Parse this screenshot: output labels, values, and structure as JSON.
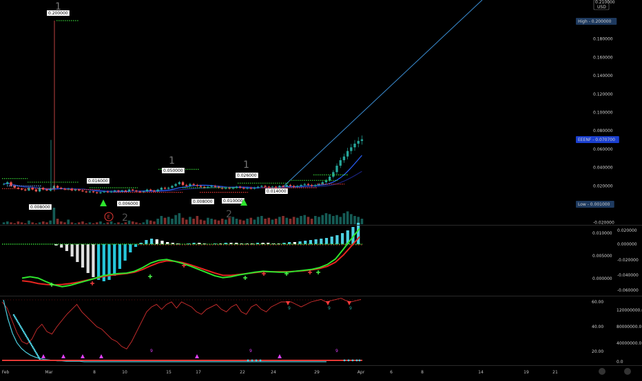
{
  "chart_data": [
    {
      "type": "candlestick",
      "panel": "price",
      "currency": "USD",
      "y_ticks": [
        "0.200000",
        "0.180000",
        "0.160000",
        "0.140000",
        "0.120000",
        "0.100000",
        "0.080000",
        "0.060000",
        "0.040000",
        "0.020000",
        "0.000000",
        "-0.020000"
      ],
      "ylim": [
        -0.02,
        0.22
      ],
      "x_ticks": [
        "Feb",
        "Mar",
        "8",
        "10",
        "15",
        "17",
        "22",
        "24",
        "29",
        "Apr",
        "6",
        "8",
        "14",
        "19",
        "21"
      ],
      "badges": {
        "high": "High - 0.200000",
        "last": "EEENF - 0.070700",
        "low": "Low - 0.001000",
        "currency": "USD",
        "top": "0.210000"
      },
      "series": [
        {
          "name": "close",
          "values": [
            0.022,
            0.024,
            0.02,
            0.018,
            0.017,
            0.016,
            0.015,
            0.018,
            0.016,
            0.014,
            0.018,
            0.016,
            0.015,
            0.017,
            0.02,
            0.018,
            0.017,
            0.016,
            0.017,
            0.015,
            0.016,
            0.015,
            0.014,
            0.013,
            0.014,
            0.013,
            0.012,
            0.013,
            0.014,
            0.013,
            0.014,
            0.015,
            0.014,
            0.015,
            0.014,
            0.016,
            0.015,
            0.014,
            0.013,
            0.014,
            0.016,
            0.015,
            0.014,
            0.016,
            0.018,
            0.017,
            0.018,
            0.02,
            0.022,
            0.024,
            0.021,
            0.02,
            0.022,
            0.021,
            0.02,
            0.019,
            0.018,
            0.019,
            0.02,
            0.019,
            0.018,
            0.017,
            0.018,
            0.017,
            0.018,
            0.019,
            0.018,
            0.017,
            0.018,
            0.017,
            0.018,
            0.019,
            0.02,
            0.019,
            0.018,
            0.019,
            0.018,
            0.02,
            0.019,
            0.021,
            0.02,
            0.019,
            0.02,
            0.021,
            0.022,
            0.021,
            0.02,
            0.021,
            0.022,
            0.024,
            0.026,
            0.03,
            0.035,
            0.042,
            0.048,
            0.052,
            0.058,
            0.062,
            0.066,
            0.069,
            0.0707
          ]
        },
        {
          "name": "volume",
          "values": [
            2,
            3,
            2,
            1,
            3,
            2,
            1,
            4,
            2,
            1,
            2,
            3,
            2,
            4,
            18,
            6,
            3,
            2,
            5,
            2,
            1,
            2,
            3,
            1,
            2,
            1,
            2,
            3,
            1,
            2,
            3,
            1,
            2,
            1,
            2,
            4,
            3,
            2,
            1,
            2,
            5,
            4,
            3,
            6,
            9,
            7,
            8,
            6,
            10,
            12,
            7,
            5,
            8,
            6,
            9,
            5,
            4,
            7,
            6,
            5,
            4,
            6,
            5,
            7,
            8,
            6,
            5,
            4,
            6,
            7,
            5,
            8,
            9,
            6,
            7,
            5,
            6,
            8,
            9,
            7,
            6,
            8,
            7,
            9,
            10,
            8,
            6,
            9,
            8,
            10,
            12,
            11,
            9,
            10,
            8,
            12,
            14,
            11,
            9,
            8,
            6
          ]
        }
      ],
      "labels": [
        {
          "text": "0.200000",
          "date_index": 13,
          "value": 0.2
        },
        {
          "text": "0.008000",
          "date_index": 8,
          "value": 0.002
        },
        {
          "text": "0.016000",
          "date_index": 24,
          "value": 0.024
        },
        {
          "text": "0.006000",
          "date_index": 33,
          "value": 0.006
        },
        {
          "text": "0.050000",
          "date_index": 44,
          "value": 0.05
        },
        {
          "text": "0.008000",
          "date_index": 54,
          "value": 0.008
        },
        {
          "text": "0.010000",
          "date_index": 63,
          "value": 0.01
        },
        {
          "text": "0.026000",
          "date_index": 65,
          "value": 0.028
        },
        {
          "text": "0.014000",
          "date_index": 73,
          "value": 0.017
        }
      ],
      "markers": {
        "wave_high": "1",
        "wave_low": "2",
        "earnings": "E"
      }
    },
    {
      "type": "histogram+line",
      "panel": "oscillator",
      "y_left_ticks": [
        "0.010000",
        "0.005000",
        "0.000000"
      ],
      "y_right_ticks": [
        "0.020000",
        "0.000000",
        "-0.020000",
        "-0.040000",
        "-0.060000"
      ],
      "series": [
        {
          "name": "hist",
          "values": [
            0,
            -0.002,
            -0.005,
            -0.01,
            -0.018,
            -0.026,
            -0.034,
            -0.042,
            -0.048,
            -0.052,
            -0.054,
            -0.052,
            -0.046,
            -0.036,
            -0.024,
            -0.012,
            -0.004,
            0.002,
            0.006,
            0.008,
            0.007,
            0.005,
            0.003,
            0.002,
            0.001,
            0.0,
            0.001,
            0.002,
            0.002,
            0.001,
            0,
            0.001,
            0.001,
            0.002,
            0.002,
            0.002,
            0.001,
            0.001,
            0.001,
            0.002,
            0.002,
            0.002,
            0.001,
            0.001,
            0.002,
            0.003,
            0.003,
            0.004,
            0.005,
            0.006,
            0.007,
            0.008,
            0.009,
            0.011,
            0.013,
            0.016,
            0.02,
            0.025,
            0.031
          ]
        },
        {
          "name": "fast",
          "values": [
            0.0001,
            0.0004,
            0.0001,
            -0.0007,
            -0.0014,
            -0.0018,
            -0.0015,
            -0.001,
            -0.0005,
            0.0,
            0.0006,
            0.0009,
            0.0011,
            0.0012,
            0.0016,
            0.0024,
            0.0034,
            0.004,
            0.0042,
            0.0038,
            0.0033,
            0.0027,
            0.002,
            0.0013,
            0.0006,
            0.0002,
            0.0004,
            0.0008,
            0.0011,
            0.0014,
            0.0016,
            0.0015,
            0.0014,
            0.0014,
            0.0016,
            0.0018,
            0.002,
            0.0024,
            0.0031,
            0.0043,
            0.0065,
            0.0088,
            0.011
          ]
        },
        {
          "name": "slow",
          "values": [
            -0.0005,
            -0.0007,
            -0.0011,
            -0.0013,
            -0.0014,
            -0.0013,
            -0.0011,
            -0.0008,
            -0.0004,
            0.0,
            0.0004,
            0.0007,
            0.0009,
            0.0011,
            0.0014,
            0.002,
            0.0028,
            0.0035,
            0.0039,
            0.0038,
            0.0035,
            0.003,
            0.0024,
            0.0018,
            0.0012,
            0.0007,
            0.0007,
            0.0009,
            0.0011,
            0.0013,
            0.0015,
            0.0015,
            0.0015,
            0.0015,
            0.0016,
            0.0017,
            0.0019,
            0.0022,
            0.0027,
            0.0036,
            0.0052,
            0.0072,
            0.0092
          ]
        }
      ]
    },
    {
      "type": "line",
      "panel": "rsi",
      "y_left_ticks": [
        "60.00",
        "40.00",
        "20.00"
      ],
      "y_right_ticks": [
        "120000000.0",
        "80000000.0",
        "40000000.0",
        "0.0"
      ],
      "series": [
        {
          "name": "rsi",
          "values": [
            60,
            55,
            45,
            35,
            28,
            26,
            30,
            38,
            42,
            36,
            34,
            40,
            45,
            50,
            54,
            58,
            52,
            48,
            44,
            40,
            38,
            34,
            30,
            28,
            24,
            22,
            28,
            36,
            44,
            52,
            56,
            58,
            54,
            58,
            60,
            55,
            60,
            58,
            56,
            52,
            50,
            54,
            56,
            58,
            54,
            52,
            56,
            58,
            52,
            50,
            56,
            58,
            54,
            52,
            56,
            58,
            60,
            60,
            60,
            58,
            56,
            58,
            60,
            61,
            62,
            60,
            61,
            62,
            63,
            61,
            60,
            61,
            62
          ]
        },
        {
          "name": "volume_decay",
          "values": [
            130,
            90,
            60,
            40,
            28,
            20,
            14,
            10,
            7,
            5,
            4,
            3,
            2,
            2,
            1,
            1,
            1,
            1,
            0,
            0,
            0,
            0,
            0,
            0,
            0,
            0,
            0,
            0,
            0,
            0,
            0,
            0,
            0,
            0,
            0,
            0,
            0,
            0,
            0,
            0,
            0,
            0,
            0,
            0,
            0,
            0,
            0,
            0,
            0,
            0,
            0,
            0,
            0,
            0,
            0,
            0,
            0,
            0,
            0,
            0,
            0,
            0,
            0,
            0,
            0,
            0,
            0,
            0,
            0,
            0,
            0,
            0,
            0
          ]
        }
      ],
      "annotations": [
        "9",
        "9",
        "9",
        "9",
        "9",
        "9"
      ]
    }
  ],
  "ui": {
    "icons": [
      "logo-a-icon",
      "logo-b-icon"
    ],
    "colors": {
      "up": "#26a69a",
      "down": "#ef5350",
      "green": "#2ee52e",
      "red": "#e8251f",
      "blue": "#2962ff",
      "cyan": "#4dd0e1",
      "magenta": "#e040fb",
      "trend": "#3b8fd6",
      "dotted_green": "#36d136",
      "dotted_red": "#e53935"
    }
  }
}
